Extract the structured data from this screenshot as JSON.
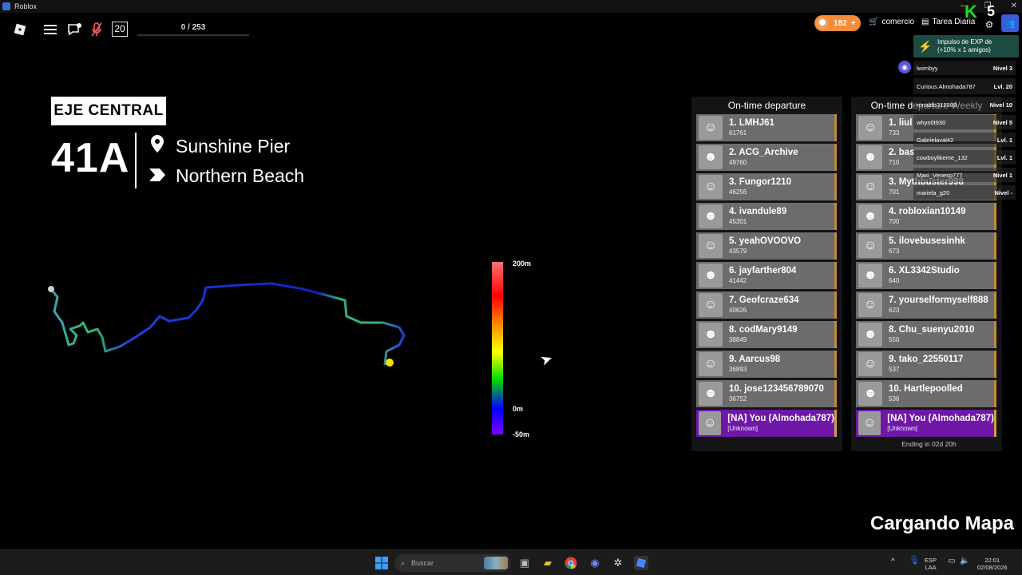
{
  "window": {
    "title": "Roblox",
    "controls": [
      "–",
      "❐",
      "✕"
    ]
  },
  "topbar": {
    "counter": "20",
    "progress_text": "0 / 253",
    "progress_fraction": 0,
    "currency_value": "182",
    "currency_plus": "+",
    "shop_label": "comercio",
    "daily_label": "Tarea Diaria",
    "k_badge": "K",
    "k_number": "5"
  },
  "route": {
    "line_name": "EJE CENTRAL",
    "number": "41A",
    "origin": "Sunshine Pier",
    "destination": "Northern Beach"
  },
  "elevation": {
    "top_label": "200m",
    "zero_label": "0m",
    "bottom_label": "-50m"
  },
  "boards": [
    {
      "title": "On-time departure",
      "rows": [
        {
          "name": "1. LMHJ61",
          "score": "61761"
        },
        {
          "name": "2. ACG_Archive",
          "score": "49760"
        },
        {
          "name": "3. Fungor1210",
          "score": "46256"
        },
        {
          "name": "4. ivandule89",
          "score": "45301"
        },
        {
          "name": "5. yeahOVOOVO",
          "score": "43579"
        },
        {
          "name": "6. jayfarther804",
          "score": "41442"
        },
        {
          "name": "7. Geofcraze634",
          "score": "40626"
        },
        {
          "name": "8. codMary9149",
          "score": "38849"
        },
        {
          "name": "9. Aarcus98",
          "score": "36893"
        },
        {
          "name": "10. jose123456789070",
          "score": "36752"
        }
      ],
      "you": {
        "name": "[NA] You (Almohada787)",
        "score": "[Unknown]"
      },
      "footer": ""
    },
    {
      "title": "On-time departure Weekly",
      "rows": [
        {
          "name": "1. liul",
          "score": "733"
        },
        {
          "name": "2. bas",
          "score": "710"
        },
        {
          "name": "3. Mythbuster998",
          "score": "701"
        },
        {
          "name": "4. robloxian10149",
          "score": "700"
        },
        {
          "name": "5. ilovebusesinhk",
          "score": "673"
        },
        {
          "name": "6. XL3342Studio",
          "score": "640"
        },
        {
          "name": "7. yourselformyself888",
          "score": "623"
        },
        {
          "name": "8. Chu_suenyu2010",
          "score": "550"
        },
        {
          "name": "9. tako_22550117",
          "score": "537"
        },
        {
          "name": "10. Hartlepoolled",
          "score": "536"
        }
      ],
      "you": {
        "name": "[NA] You (Almohada787)",
        "score": "[Unknown]"
      },
      "footer": "Ending in 02d 20h"
    }
  ],
  "boost": {
    "line1": "Impulso de EXP de",
    "line2": "(+10% x 1 amigos)"
  },
  "friends": [
    {
      "name": "lwimbyy",
      "level": "Nivel 3"
    },
    {
      "name": "Curious Almohada787",
      "level": "Lvl. 20"
    },
    {
      "name": "ronaldo312389",
      "level": "Nivel 10"
    },
    {
      "name": "whyn0t930",
      "level": "Nivel 5"
    },
    {
      "name": "Gabrielaval42",
      "level": "Lvl. 1"
    },
    {
      "name": "cowboylikeme_132",
      "level": "Lvl. 1"
    },
    {
      "name": "Maxi_Veneso777",
      "level": "Nivel 1"
    },
    {
      "name": "mariela_g20",
      "level": "Nivel -"
    }
  ],
  "status": {
    "loading": "Cargando Mapa"
  },
  "taskbar": {
    "search_placeholder": "Buscar",
    "lang": "ESP",
    "region": "LAA",
    "time": "22:01",
    "date": "02/08/2026"
  }
}
